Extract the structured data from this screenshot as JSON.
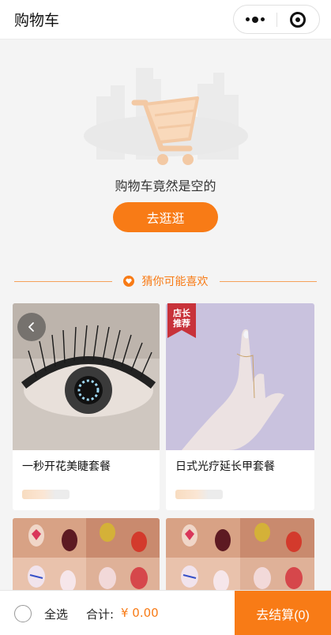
{
  "header": {
    "title": "购物车",
    "more_icon": "more-dots-icon",
    "close_icon": "target-close-icon"
  },
  "empty": {
    "illustration_icon": "shopping-cart-icon",
    "message": "购物车竟然是空的",
    "button_label": "去逛逛"
  },
  "recommend": {
    "label": "猜你可能喜欢",
    "icon": "heart-icon",
    "badge_text": "店长推荐",
    "products": [
      {
        "name": "一秒开花美睫套餐"
      },
      {
        "name": "日式光疗延长甲套餐"
      }
    ]
  },
  "bottom": {
    "select_all": "全选",
    "total_label": "合计:",
    "total_value": "¥ 0.00",
    "checkout_label": "去结算(0)"
  },
  "colors": {
    "accent": "#f87b16",
    "background": "#f4f4f4"
  }
}
